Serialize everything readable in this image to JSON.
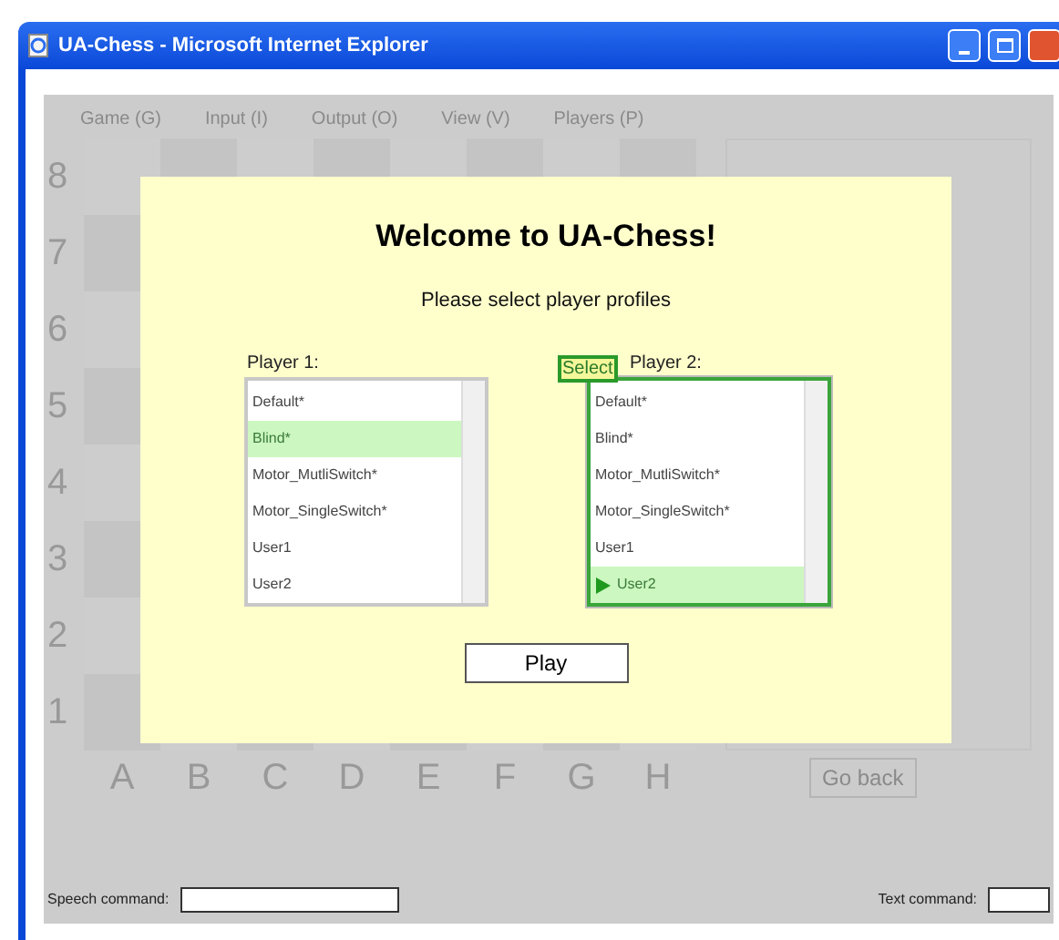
{
  "window": {
    "title": "UA-Chess - Microsoft Internet Explorer"
  },
  "menu": [
    "Game (G)",
    "Input (I)",
    "Output (O)",
    "View (V)",
    "Players (P)"
  ],
  "board": {
    "ranks": [
      "8",
      "7",
      "6",
      "5",
      "4",
      "3",
      "2",
      "1"
    ],
    "files": [
      "A",
      "B",
      "C",
      "D",
      "E",
      "F",
      "G",
      "H"
    ],
    "back_button": "Go back"
  },
  "dialog": {
    "title": "Welcome to UA-Chess!",
    "subtitle": "Please select player profiles",
    "play_button": "Play",
    "players": [
      {
        "label": "Player 1:",
        "focused": false,
        "items": [
          {
            "label": "Default*",
            "selected": false
          },
          {
            "label": "Blind*",
            "selected": true
          },
          {
            "label": "Motor_MutliSwitch*",
            "selected": false
          },
          {
            "label": "Motor_SingleSwitch*",
            "selected": false
          },
          {
            "label": "User1",
            "selected": false
          },
          {
            "label": "User2",
            "selected": false
          }
        ]
      },
      {
        "label": "Player 2:",
        "focused": true,
        "tooltip": "Select",
        "items": [
          {
            "label": "Default*",
            "selected": false
          },
          {
            "label": "Blind*",
            "selected": false
          },
          {
            "label": "Motor_MutliSwitch*",
            "selected": false
          },
          {
            "label": "Motor_SingleSwitch*",
            "selected": false
          },
          {
            "label": "User1",
            "selected": false
          },
          {
            "label": "User2",
            "selected": true
          }
        ]
      }
    ]
  },
  "status": {
    "speech_label": "Speech command:",
    "text_label": "Text command:"
  }
}
